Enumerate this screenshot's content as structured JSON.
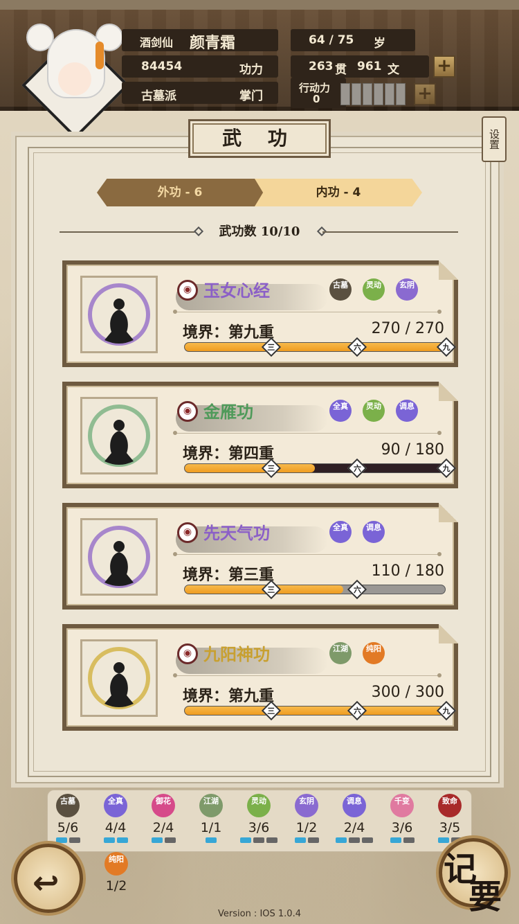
{
  "header": {
    "title_label": "酒剑仙",
    "name": "颜青霜",
    "age": "64 / 75",
    "age_unit": "岁",
    "power_value": "84454",
    "power_label": "功力",
    "money_guan": "263",
    "guan_label": "贯",
    "money_wen": "961",
    "wen_label": "文",
    "sect": "古墓派",
    "rank": "掌门",
    "action_label": "行动力",
    "action_value": "0",
    "plus_symbol": "+"
  },
  "page": {
    "title": "武 功",
    "settings_label": "设置"
  },
  "tabs": {
    "outer_label": "外功 - 6",
    "inner_label": "内功 - 4",
    "selected": "inner"
  },
  "skill_count": "武功数 10/10",
  "skills": [
    {
      "name": "玉女心经",
      "name_color": "#8b5fc7",
      "ring_color": "#9a74c9",
      "realm": "境界：第九重",
      "exp": "270 / 270",
      "progress": 1.0,
      "track": "dark",
      "marks": [
        "三",
        "六",
        "九"
      ],
      "tags": [
        {
          "text": "古墓",
          "color": "#5a5040"
        },
        {
          "text": "灵动",
          "color": "#7bb04a"
        },
        {
          "text": "玄阴",
          "color": "#8a6ad0"
        }
      ]
    },
    {
      "name": "金雁功",
      "name_color": "#4f9a5a",
      "ring_color": "#7fb486",
      "realm": "境界：第四重",
      "exp": "90 / 180",
      "progress": 0.5,
      "track": "dark",
      "marks": [
        "三",
        "六",
        "九"
      ],
      "tags": [
        {
          "text": "全真",
          "color": "#7a64d6"
        },
        {
          "text": "灵动",
          "color": "#7bb04a"
        },
        {
          "text": "调息",
          "color": "#7a64d6"
        }
      ]
    },
    {
      "name": "先天气功",
      "name_color": "#8b5fc7",
      "ring_color": "#9a74c9",
      "realm": "境界：第三重",
      "exp": "110 / 180",
      "progress": 0.61,
      "track": "grey",
      "marks": [
        "三",
        "六"
      ],
      "tags": [
        {
          "text": "全真",
          "color": "#7a64d6"
        },
        {
          "text": "调息",
          "color": "#7a64d6"
        }
      ]
    },
    {
      "name": "九阳神功",
      "name_color": "#c8a030",
      "ring_color": "#d4b54a",
      "realm": "境界：第九重",
      "exp": "300 / 300",
      "progress": 1.0,
      "track": "dark",
      "marks": [
        "三",
        "六",
        "九"
      ],
      "tags": [
        {
          "text": "江湖",
          "color": "#7e9a6a"
        },
        {
          "text": "纯阳",
          "color": "#e27a25"
        }
      ]
    }
  ],
  "tally": [
    {
      "text": "古墓",
      "count": "5/6",
      "color": "#5a5040",
      "on": 1,
      "total": 2
    },
    {
      "text": "全真",
      "count": "4/4",
      "color": "#7a64d6",
      "on": 2,
      "total": 2
    },
    {
      "text": "御花",
      "count": "2/4",
      "color": "#d64a8a",
      "on": 1,
      "total": 2
    },
    {
      "text": "江湖",
      "count": "1/1",
      "color": "#7e9a6a",
      "on": 1,
      "total": 1
    },
    {
      "text": "灵动",
      "count": "3/6",
      "color": "#7bb04a",
      "on": 1,
      "total": 3
    },
    {
      "text": "玄阴",
      "count": "1/2",
      "color": "#8a6ad0",
      "on": 1,
      "total": 2
    },
    {
      "text": "调息",
      "count": "2/4",
      "color": "#7a64d6",
      "on": 1,
      "total": 3
    },
    {
      "text": "千变",
      "count": "3/6",
      "color": "#e07aa0",
      "on": 1,
      "total": 2
    },
    {
      "text": "致命",
      "count": "3/5",
      "color": "#a82a2a",
      "on": 1,
      "total": 2
    },
    {
      "text": "纯阳",
      "count": "1/2",
      "color": "#e27a25",
      "on": 0,
      "total": 0
    }
  ],
  "buttons": {
    "back_icon": "↩",
    "memo_label_1": "记",
    "memo_label_2": "要"
  },
  "version": "Version : IOS 1.0.4"
}
